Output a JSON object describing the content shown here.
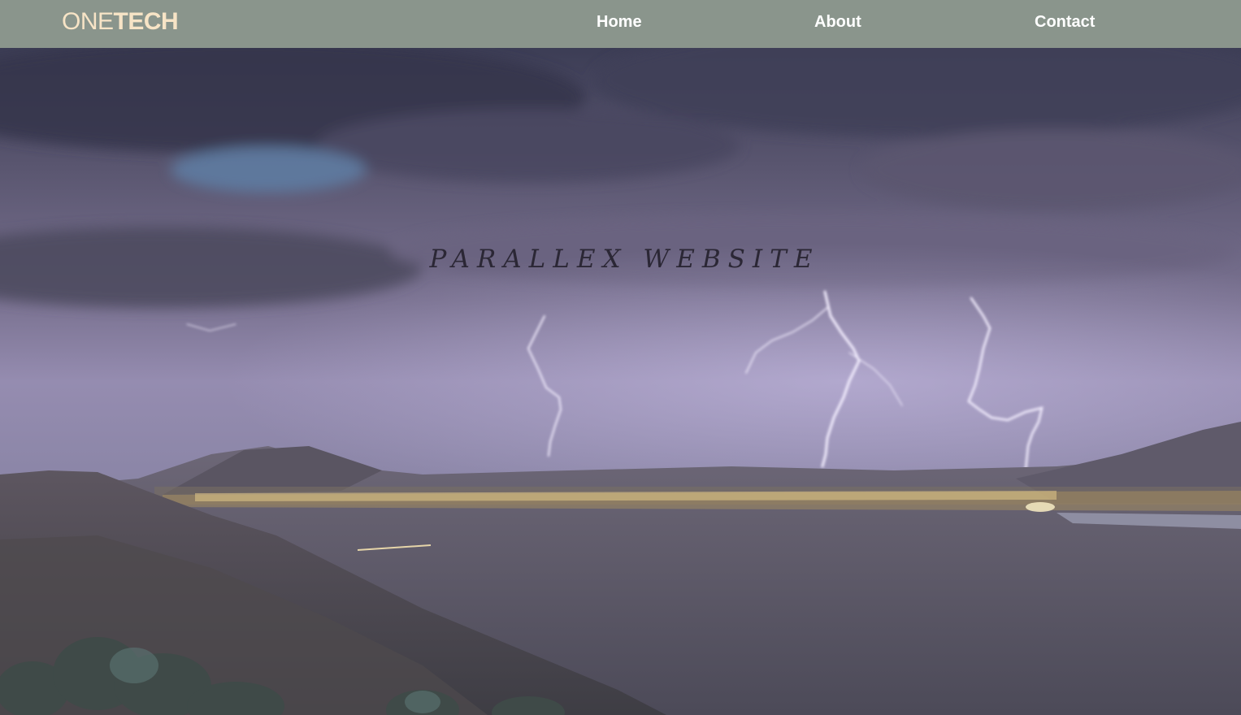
{
  "nav": {
    "logo_light": "ONE",
    "logo_bold": "TECH",
    "links": [
      "Home",
      "About",
      "Contact"
    ]
  },
  "hero": {
    "title": "PARALLEX WEBSITE",
    "image": "lightning-storm-over-city-valley"
  },
  "colors": {
    "navbar_bg": "#8a958c",
    "logo": "#f7e4c6",
    "nav_link": "#ffffff",
    "hero_title": "#2b2735"
  }
}
